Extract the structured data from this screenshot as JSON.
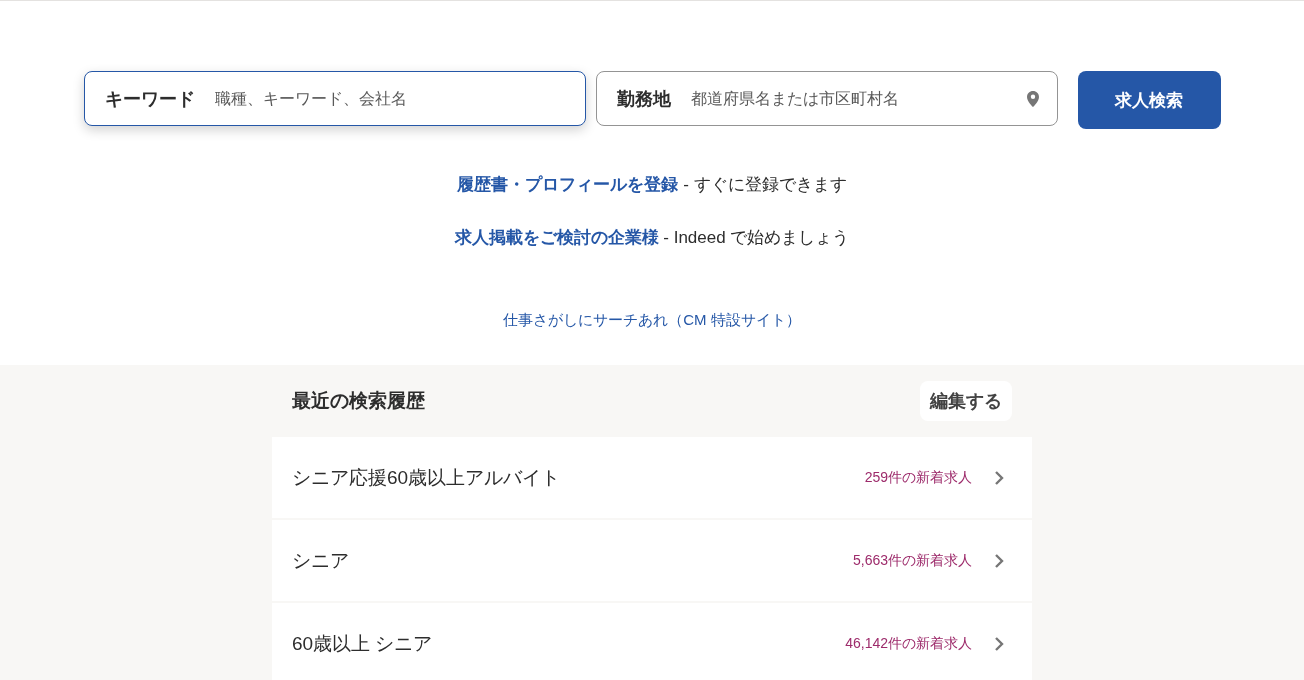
{
  "search": {
    "keyword": {
      "label": "キーワード",
      "placeholder": "職種、キーワード、会社名",
      "focused": true
    },
    "location": {
      "label": "勤務地",
      "placeholder": "都道府県名または市区町村名"
    },
    "button": "求人検索"
  },
  "prompts": [
    {
      "link": "履歴書・プロフィールを登録",
      "text": " - すぐに登録できます"
    },
    {
      "link": "求人掲載をご検討の企業様",
      "text": " - Indeed で始めましょう"
    }
  ],
  "promo_link": "仕事さがしにサーチあれ（CM 特設サイト）",
  "history": {
    "title": "最近の検索履歴",
    "edit_button": "編集する",
    "items": [
      {
        "query": "シニア応援60歳以上アルバイト",
        "count": "259件の新着求人"
      },
      {
        "query": "シニア",
        "count": "5,663件の新着求人"
      },
      {
        "query": "60歳以上 シニア",
        "count": "46,142件の新着求人"
      }
    ]
  }
}
